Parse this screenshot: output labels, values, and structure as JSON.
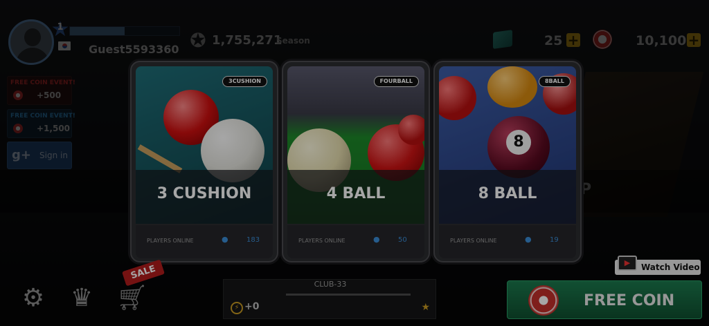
{
  "player": {
    "level": "1",
    "username": "Guest5593360",
    "xp_fraction": 0.5
  },
  "season": {
    "points": "1,755,271",
    "label": "Season"
  },
  "currency": {
    "chalk": "25",
    "coins": "10,100"
  },
  "promos": [
    {
      "title": "FREE COIN EVENT!",
      "value": "+500"
    },
    {
      "title": "FREE COIN EVENT!",
      "value": "+1,500"
    }
  ],
  "signin": {
    "g": "g+",
    "label": "Sign in"
  },
  "background_mode_letter": "P",
  "cards": [
    {
      "name": "3 CUSHION",
      "badge": "3CUSHION",
      "players_label": "PLAYERS ONLINE",
      "count": "183"
    },
    {
      "name": "4 BALL",
      "badge": "FOURBALL",
      "players_label": "PLAYERS ONLINE",
      "count": "50"
    },
    {
      "name": "8 BALL",
      "badge": "8BALL",
      "players_label": "PLAYERS ONLINE",
      "count": "19"
    }
  ],
  "bottom": {
    "sale": "SALE",
    "club_name": "CLUB-33",
    "club_value": "+0",
    "watch_video": "Watch Video",
    "free_coin": "FREE COIN"
  },
  "icons": {
    "settings": "gear-icon",
    "rank": "crown-icon",
    "shop": "cart-icon"
  }
}
